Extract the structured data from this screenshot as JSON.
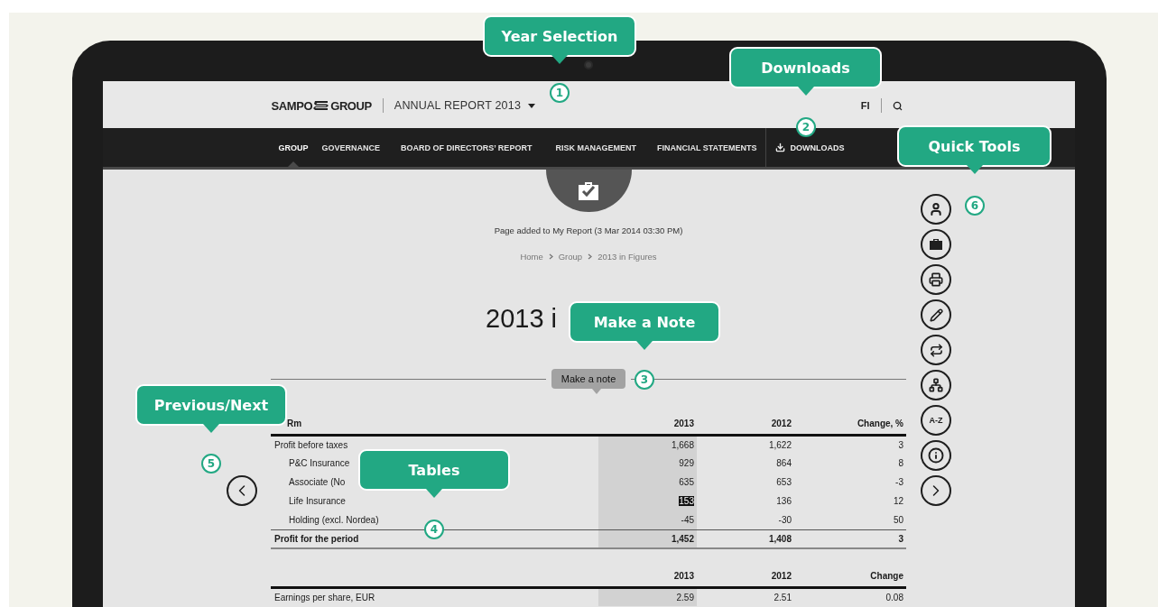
{
  "header": {
    "brand_left": "SAMPO",
    "brand_right": "GROUP",
    "report": "ANNUAL REPORT 2013",
    "language": "FI"
  },
  "nav": [
    {
      "label": "GROUP",
      "selected": true
    },
    {
      "label": "GOVERNANCE",
      "selected": false
    },
    {
      "label": "BOARD OF DIRECTORS’ REPORT",
      "selected": false
    },
    {
      "label": "RISK MANAGEMENT",
      "selected": false
    },
    {
      "label": "FINANCIAL STATEMENTS",
      "selected": false
    }
  ],
  "downloads": "DOWNLOADS",
  "notice": "Page added to My Report (3 Mar 2014 03:30 PM)",
  "breadcrumb": [
    {
      "label": "Home"
    },
    {
      "label": "Group"
    },
    {
      "label": "2013 in Figures"
    }
  ],
  "title": "2013 i",
  "note_button": "Make a note",
  "tables": [
    {
      "label_header": "Rm",
      "columns": [
        "2013",
        "2012",
        "Change, %"
      ],
      "rows": [
        {
          "label": "Profit before taxes",
          "kind": "normal",
          "cells": [
            {
              "text": "1,668",
              "selected": false
            },
            {
              "text": "1,622",
              "selected": false
            },
            {
              "text": "3",
              "selected": false
            }
          ],
          "children": [
            {
              "label": "P&C Insurance",
              "kind": "normal",
              "cells": [
                {
                  "text": "929",
                  "selected": false
                },
                {
                  "text": "864",
                  "selected": false
                },
                {
                  "text": "8",
                  "selected": false
                }
              ]
            },
            {
              "label": "Associate (No",
              "kind": "normal",
              "cells": [
                {
                  "text": "635",
                  "selected": false
                },
                {
                  "text": "653",
                  "selected": false
                },
                {
                  "text": "-3",
                  "selected": false
                }
              ]
            },
            {
              "label": "Life Insurance",
              "kind": "normal",
              "cells": [
                {
                  "text": "153",
                  "selected": true
                },
                {
                  "text": "136",
                  "selected": false
                },
                {
                  "text": "12",
                  "selected": false
                }
              ]
            },
            {
              "label": "Holding (excl. Nordea)",
              "kind": "normal",
              "cells": [
                {
                  "text": "-45",
                  "selected": false
                },
                {
                  "text": "-30",
                  "selected": false
                },
                {
                  "text": "50",
                  "selected": false
                }
              ]
            }
          ]
        },
        {
          "label": "Profit for the period",
          "kind": "total",
          "cells": [
            {
              "text": "1,452",
              "selected": false
            },
            {
              "text": "1,408",
              "selected": false
            },
            {
              "text": "3",
              "selected": false
            }
          ]
        }
      ]
    },
    {
      "columns": [
        "2013",
        "2012",
        "Change"
      ],
      "rows": [
        {
          "label": "Earnings per share, EUR",
          "kind": "normal",
          "cells": [
            {
              "text": "2.59",
              "selected": false
            },
            {
              "text": "2.51",
              "selected": false
            },
            {
              "text": "0.08",
              "selected": false
            }
          ]
        }
      ]
    }
  ],
  "quick_tools": [
    {
      "kind": "person"
    },
    {
      "kind": "briefcase"
    },
    {
      "kind": "print"
    },
    {
      "kind": "pencil"
    },
    {
      "kind": "link"
    },
    {
      "kind": "sitemap"
    },
    {
      "kind": "text",
      "label": "A-Z"
    },
    {
      "kind": "info"
    },
    {
      "kind": "next"
    }
  ],
  "callouts": [
    {
      "label": "Year Selection",
      "number": "1"
    },
    {
      "label": "Downloads",
      "number": "2"
    },
    {
      "label": "Make a Note",
      "number": "3"
    },
    {
      "label": "Tables",
      "number": "4"
    },
    {
      "label": "Previous/Next",
      "number": "5"
    },
    {
      "label": "Quick Tools",
      "number": "6"
    }
  ]
}
